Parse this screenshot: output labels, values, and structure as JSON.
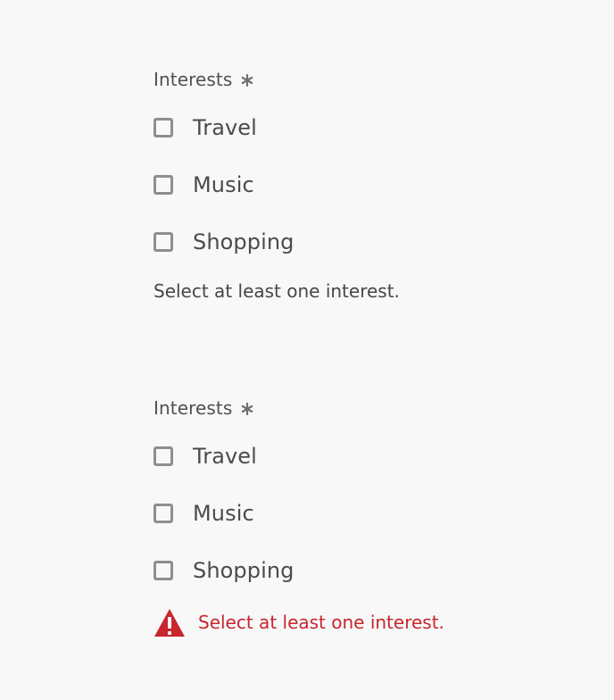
{
  "colors": {
    "background": "#f8f8f8",
    "text": "#4b4b4b",
    "checkbox_border": "#8e8e8e",
    "error": "#c9252d"
  },
  "groups": [
    {
      "label": "Interests",
      "required_icon": "asterisk-icon",
      "options": [
        {
          "label": "Travel",
          "checked": false
        },
        {
          "label": "Music",
          "checked": false
        },
        {
          "label": "Shopping",
          "checked": false
        }
      ],
      "help_text": "Select at least one interest."
    },
    {
      "label": "Interests",
      "required_icon": "asterisk-icon",
      "options": [
        {
          "label": "Travel",
          "checked": false
        },
        {
          "label": "Music",
          "checked": false
        },
        {
          "label": "Shopping",
          "checked": false
        }
      ],
      "error_icon": "alert-triangle-icon",
      "error_text": "Select at least one interest."
    }
  ]
}
